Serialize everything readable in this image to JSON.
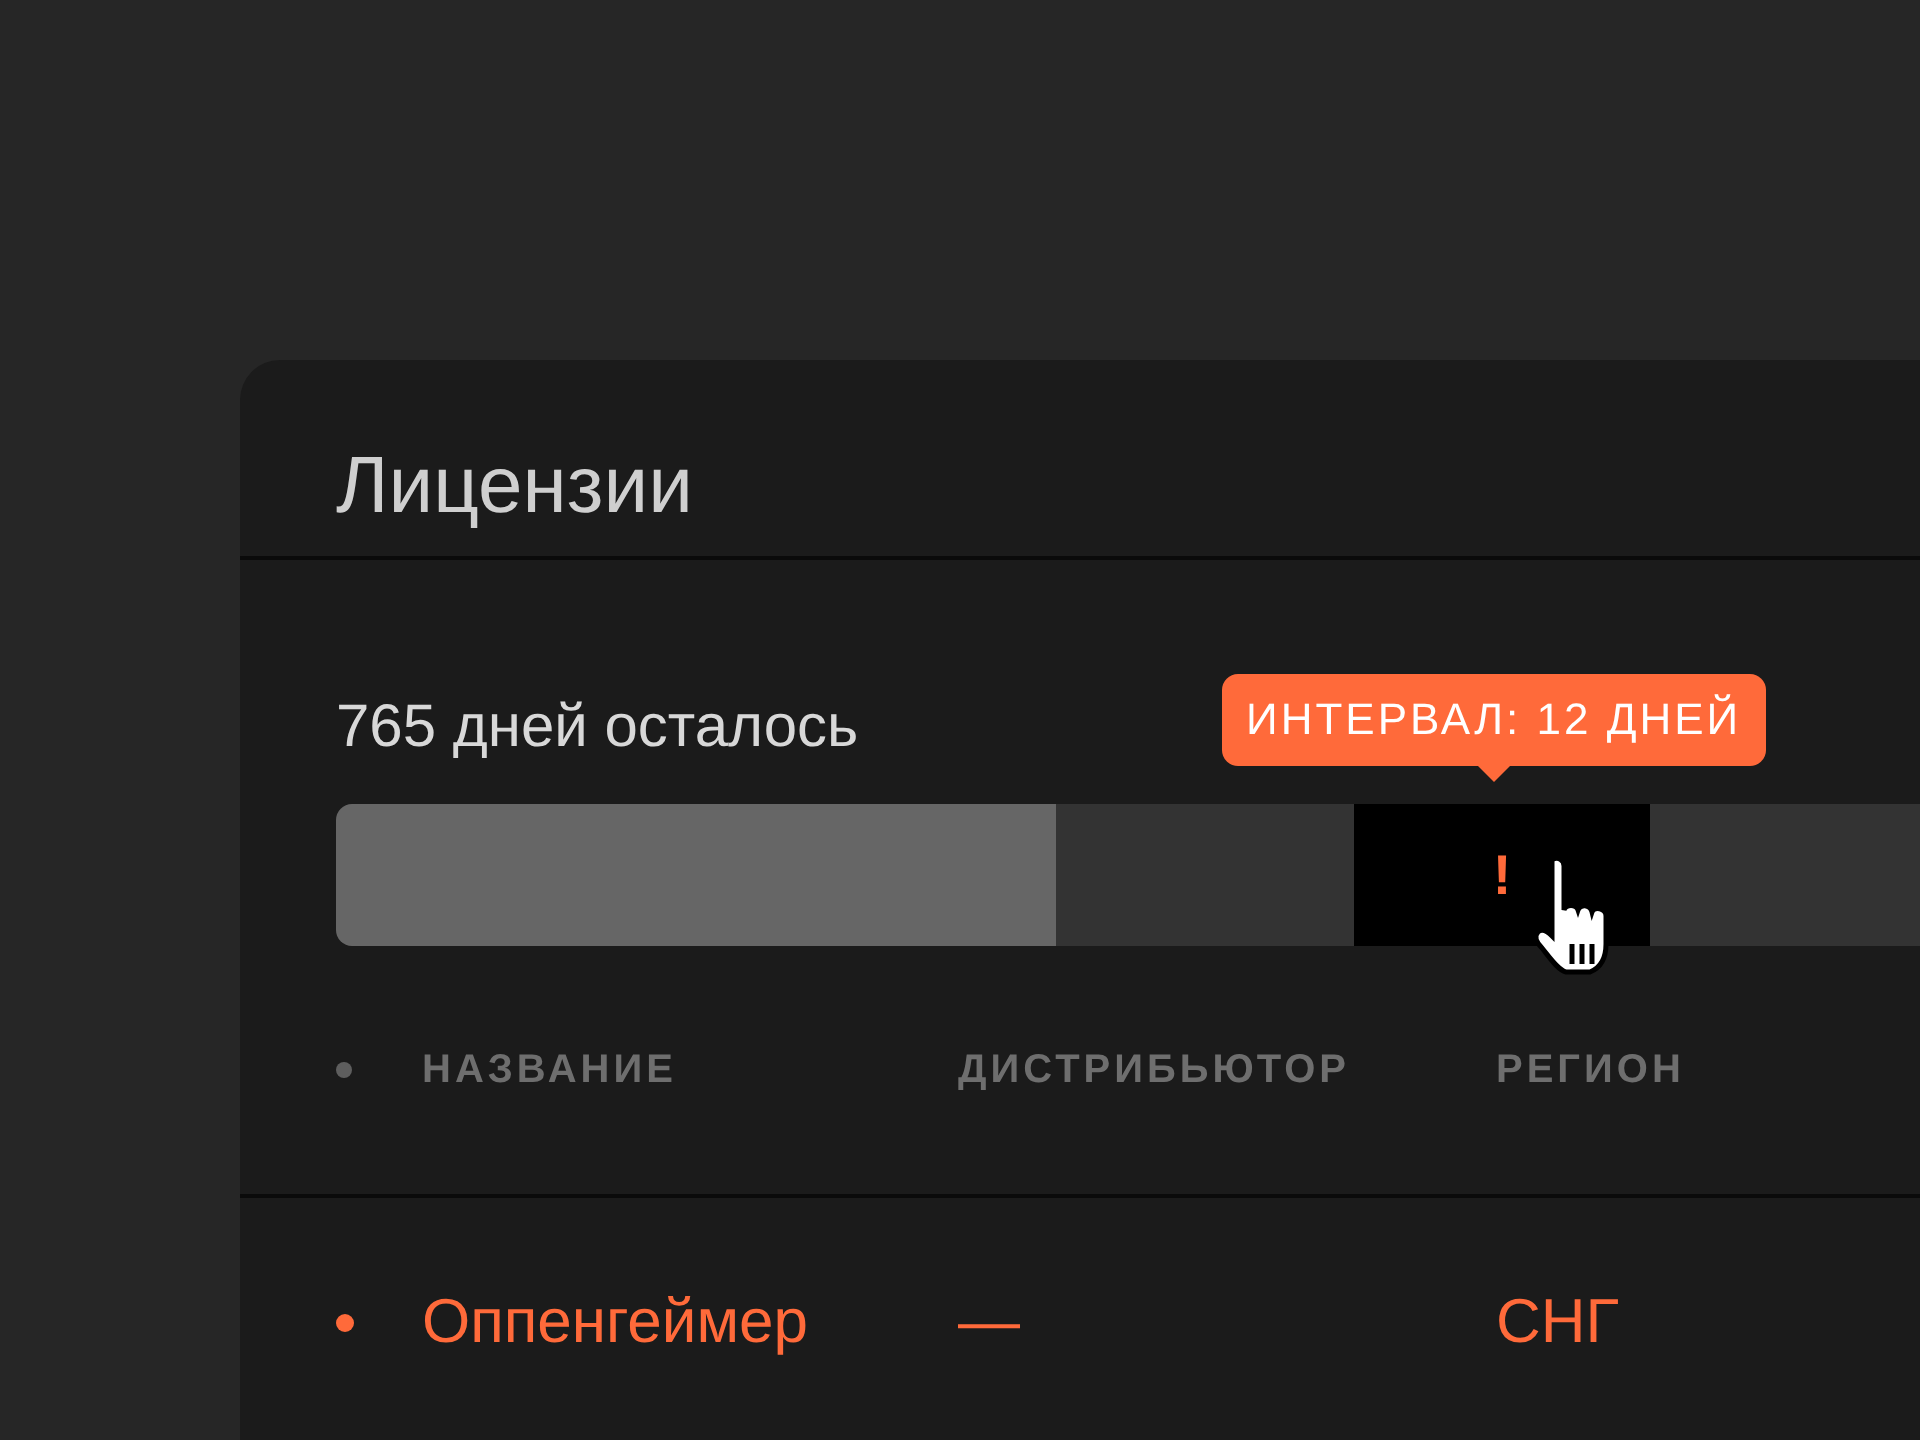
{
  "panel": {
    "title": "Лицензии"
  },
  "timeline": {
    "remaining_label": "765 дней осталось",
    "tooltip": "ИНТЕРВАЛ: 12 ДНЕЙ",
    "segments": [
      {
        "kind": "elapsed",
        "selected": false
      },
      {
        "kind": "remaining",
        "selected": false
      },
      {
        "kind": "interval",
        "selected": true,
        "marker": "!"
      },
      {
        "kind": "remaining",
        "selected": false
      }
    ]
  },
  "table": {
    "columns": [
      "НАЗВАНИЕ",
      "ДИСТРИБЬЮТОР",
      "РЕГИОН"
    ],
    "rows": [
      {
        "color": "#ff6a3a",
        "cells": [
          "Оппенгеймер",
          "—",
          "СНГ"
        ]
      }
    ]
  }
}
